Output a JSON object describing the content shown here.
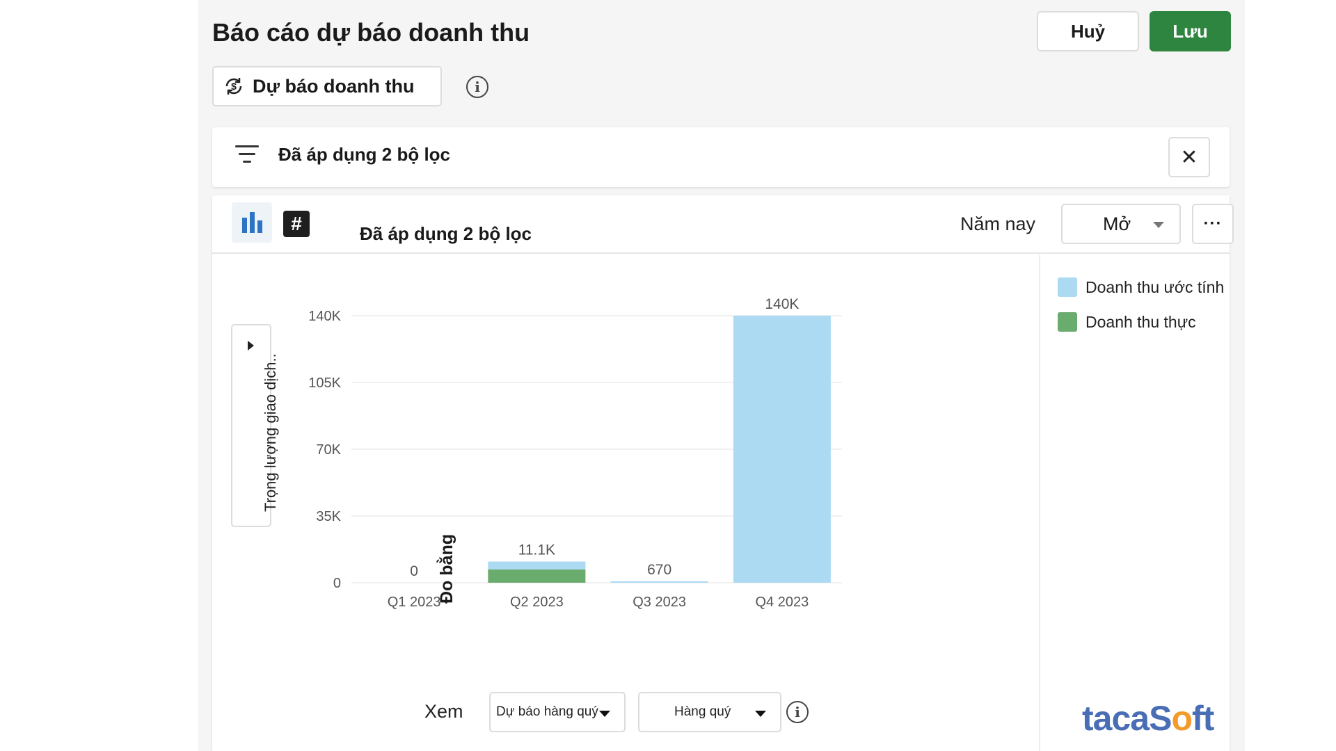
{
  "header": {
    "title": "Báo cáo dự báo doanh thu",
    "cancel_label": "Huỷ",
    "save_label": "Lưu"
  },
  "report_selector": {
    "label": "Dự báo doanh thu",
    "icon": "revenue-forecast-icon"
  },
  "filter_bar": {
    "text": "Đã áp dụng 2 bộ lọc",
    "icon": "filter-icon",
    "close_icon": "close-icon"
  },
  "toolbar": {
    "title": "Đã áp dụng 2 bộ lọc",
    "period_label": "Năm nay",
    "dropdown_value": "Mở",
    "more_label": "···",
    "hash_label": "#"
  },
  "measure": {
    "selector_text": "Trọng lượng giao dịch..",
    "label": "Đo bằng"
  },
  "footer": {
    "view_label": "Xem",
    "forecast_select": "Dự báo hàng quý",
    "period_select": "Hàng quý"
  },
  "logo": {
    "part1": "tacaS",
    "part2": "o",
    "part3": "ft"
  },
  "colors": {
    "estimated": "#acdaf3",
    "actual": "#6aab6e",
    "save_button": "#2e8540"
  },
  "chart_data": {
    "type": "bar",
    "stacked": true,
    "categories": [
      "Q1 2023",
      "Q2 2023",
      "Q3 2023",
      "Q4 2023"
    ],
    "series": [
      {
        "name": "Doanh thu thực",
        "values": [
          0,
          7000,
          0,
          0
        ]
      },
      {
        "name": "Doanh thu ước tính",
        "values": [
          0,
          4100,
          670,
          140000
        ]
      }
    ],
    "totals_labels": [
      "0",
      "11.1K",
      "670",
      "140K"
    ],
    "y_ticks": [
      0,
      35000,
      70000,
      105000,
      140000
    ],
    "y_tick_labels": [
      "0",
      "35K",
      "70K",
      "105K",
      "140K"
    ],
    "ylim": [
      0,
      140000
    ],
    "legend": [
      "Doanh thu ước tính",
      "Doanh thu thực"
    ],
    "legend_position": "right",
    "grid": true
  }
}
